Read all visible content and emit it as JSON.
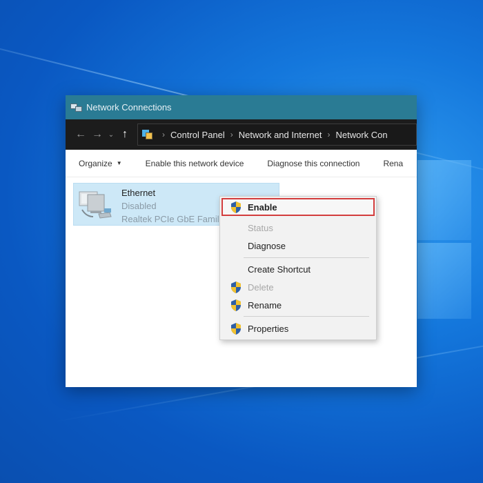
{
  "window": {
    "title": "Network Connections"
  },
  "addressbar": {
    "breadcrumbs": [
      "Control Panel",
      "Network and Internet",
      "Network Con"
    ]
  },
  "commandbar": {
    "organize": "Organize",
    "enable_device": "Enable this network device",
    "diagnose": "Diagnose this connection",
    "rename": "Rena"
  },
  "connection": {
    "name": "Ethernet",
    "status": "Disabled",
    "adapter": "Realtek PCIe GbE Famil"
  },
  "context_menu": {
    "items": [
      {
        "label": "Enable",
        "icon": "shield-icon",
        "state": "highlighted"
      },
      {
        "label": "Status",
        "icon": "",
        "state": "disabled"
      },
      {
        "label": "Diagnose",
        "icon": "",
        "state": "enabled"
      },
      {
        "label": "Create Shortcut",
        "icon": "",
        "state": "enabled"
      },
      {
        "label": "Delete",
        "icon": "shield-icon",
        "state": "disabled"
      },
      {
        "label": "Rename",
        "icon": "shield-icon",
        "state": "enabled"
      },
      {
        "label": "Properties",
        "icon": "shield-icon",
        "state": "enabled"
      }
    ]
  },
  "colors": {
    "highlight_border": "#d33c3c",
    "titlebar": "#2a7b94",
    "selection": "#cde8f7"
  }
}
